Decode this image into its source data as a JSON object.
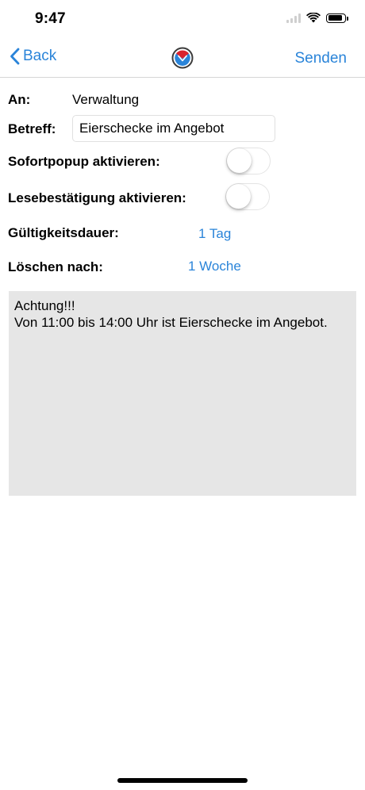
{
  "status_bar": {
    "time": "9:47",
    "icons": [
      "cellular-signal-icon",
      "wifi-icon",
      "battery-icon"
    ],
    "battery_level": 0.9
  },
  "nav": {
    "back_label": "Back",
    "logo_icon": "app-logo-icon",
    "send_label": "Senden"
  },
  "form": {
    "to_label": "An:",
    "to_value": "Verwaltung",
    "subject_label": "Betreff:",
    "subject_value": "Eierschecke im Angebot",
    "popup_label": "Sofortpopup aktivieren:",
    "popup_enabled": false,
    "read_receipt_label": "Lesebestätigung aktivieren:",
    "read_receipt_enabled": false,
    "validity_label": "Gültigkeitsdauer:",
    "validity_value": "1 Tag",
    "delete_label": "Löschen nach:",
    "delete_value": "1 Woche",
    "message": "Achtung!!!\nVon 11:00 bis 14:00 Uhr ist Eierschecke im Angebot."
  },
  "colors": {
    "accent": "#2a84d9",
    "message_background": "#e6e6e6",
    "logo_red": "#d9232e",
    "logo_blue": "#2a84d9"
  }
}
